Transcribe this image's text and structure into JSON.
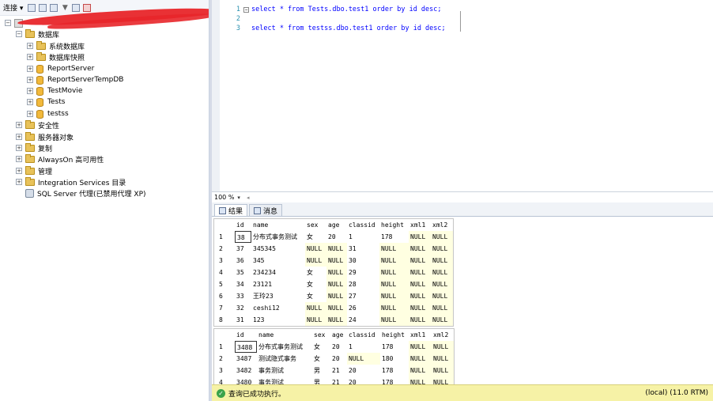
{
  "toolbar": {
    "connect_label": "连接 ▾"
  },
  "tree": [
    {
      "label": "数据库",
      "kind": "folder",
      "exp": "⊟",
      "indent": 0
    },
    {
      "label": "系统数据库",
      "kind": "folder",
      "exp": "⊞",
      "indent": 1
    },
    {
      "label": "数据库快照",
      "kind": "folder",
      "exp": "⊞",
      "indent": 1
    },
    {
      "label": "ReportServer",
      "kind": "db",
      "exp": "⊞",
      "indent": 1
    },
    {
      "label": "ReportServerTempDB",
      "kind": "db",
      "exp": "⊞",
      "indent": 1
    },
    {
      "label": "TestMovie",
      "kind": "db",
      "exp": "⊞",
      "indent": 1
    },
    {
      "label": "Tests",
      "kind": "db",
      "exp": "⊞",
      "indent": 1
    },
    {
      "label": "testss",
      "kind": "db",
      "exp": "⊞",
      "indent": 1
    },
    {
      "label": "安全性",
      "kind": "folder",
      "exp": "⊞",
      "indent": 0
    },
    {
      "label": "服务器对象",
      "kind": "folder",
      "exp": "⊞",
      "indent": 0
    },
    {
      "label": "复制",
      "kind": "folder",
      "exp": "⊞",
      "indent": 0
    },
    {
      "label": "AlwaysOn 高可用性",
      "kind": "folder",
      "exp": "⊞",
      "indent": 0
    },
    {
      "label": "管理",
      "kind": "folder",
      "exp": "⊞",
      "indent": 0
    },
    {
      "label": "Integration Services 目录",
      "kind": "folder",
      "exp": "⊞",
      "indent": 0
    },
    {
      "label": "SQL Server 代理(已禁用代理 XP)",
      "kind": "agent",
      "exp": "",
      "indent": 0
    }
  ],
  "editor": {
    "lines": [
      {
        "num": "1",
        "code": "select * from Tests.dbo.test1 order by id desc;"
      },
      {
        "num": "2",
        "code": ""
      },
      {
        "num": "3",
        "code": "select * from testss.dbo.test1 order by id desc;"
      }
    ]
  },
  "zoom": {
    "value": "100 %"
  },
  "tabs": {
    "results": "结果",
    "messages": "消息"
  },
  "columns": [
    "id",
    "name",
    "sex",
    "age",
    "classid",
    "height",
    "xml1",
    "xml2"
  ],
  "grid1": [
    [
      "1",
      "38",
      "分布式事务测试",
      "女",
      "20",
      "1",
      "178",
      "NULL",
      "NULL"
    ],
    [
      "2",
      "37",
      "345345",
      "NULL",
      "NULL",
      "31",
      "NULL",
      "NULL",
      "NULL"
    ],
    [
      "3",
      "36",
      "345",
      "NULL",
      "NULL",
      "30",
      "NULL",
      "NULL",
      "NULL"
    ],
    [
      "4",
      "35",
      "234234",
      "女",
      "NULL",
      "29",
      "NULL",
      "NULL",
      "NULL"
    ],
    [
      "5",
      "34",
      "23121",
      "女",
      "NULL",
      "28",
      "NULL",
      "NULL",
      "NULL"
    ],
    [
      "6",
      "33",
      "王玲23",
      "女",
      "NULL",
      "27",
      "NULL",
      "NULL",
      "NULL"
    ],
    [
      "7",
      "32",
      "ceshi12",
      "NULL",
      "NULL",
      "26",
      "NULL",
      "NULL",
      "NULL"
    ],
    [
      "8",
      "31",
      "123",
      "NULL",
      "NULL",
      "24",
      "NULL",
      "NULL",
      "NULL"
    ]
  ],
  "grid2": [
    [
      "1",
      "3488",
      "分布式事务测试",
      "女",
      "20",
      "1",
      "178",
      "NULL",
      "NULL"
    ],
    [
      "2",
      "3487",
      "测试隐式事务",
      "女",
      "20",
      "NULL",
      "180",
      "NULL",
      "NULL"
    ],
    [
      "3",
      "3482",
      "事务测试",
      "男",
      "21",
      "20",
      "178",
      "NULL",
      "NULL"
    ],
    [
      "4",
      "3480",
      "事务测试",
      "男",
      "21",
      "20",
      "178",
      "NULL",
      "NULL"
    ]
  ],
  "status": {
    "message": "查询已成功执行。",
    "server": "(local) (11.0 RTM)"
  }
}
